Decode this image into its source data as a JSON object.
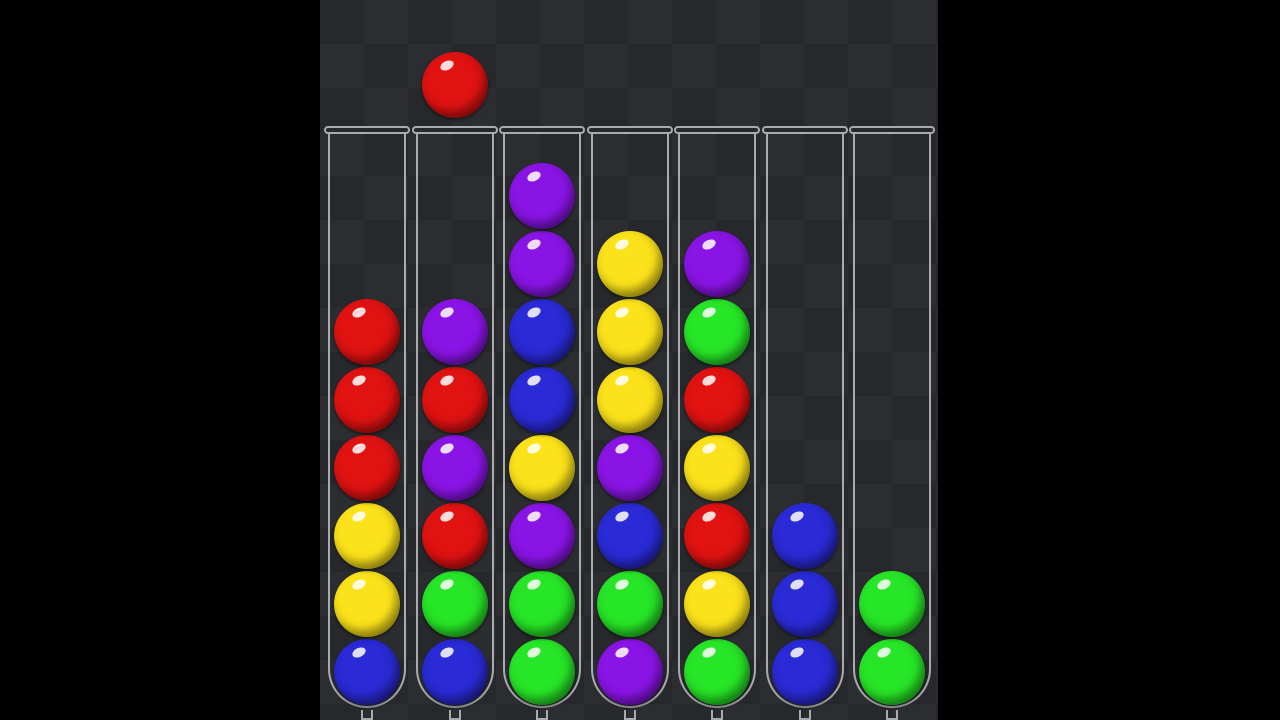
{
  "game": {
    "colors": {
      "red": "#e01212",
      "purple": "#8a14e6",
      "blue": "#2a2ad6",
      "yellow": "#fbe21a",
      "green": "#27e527"
    },
    "held_ball": {
      "color": "red",
      "above_tube": 1
    },
    "tubes": [
      {
        "balls_bottom_to_top": [
          "blue",
          "yellow",
          "yellow",
          "red",
          "red",
          "red"
        ]
      },
      {
        "balls_bottom_to_top": [
          "blue",
          "green",
          "red",
          "purple",
          "red",
          "purple"
        ]
      },
      {
        "balls_bottom_to_top": [
          "green",
          "green",
          "purple",
          "yellow",
          "blue",
          "blue",
          "purple",
          "purple"
        ]
      },
      {
        "balls_bottom_to_top": [
          "purple",
          "green",
          "blue",
          "purple",
          "yellow",
          "yellow",
          "yellow"
        ]
      },
      {
        "balls_bottom_to_top": [
          "green",
          "yellow",
          "red",
          "yellow",
          "red",
          "green",
          "purple"
        ]
      },
      {
        "balls_bottom_to_top": [
          "blue",
          "blue",
          "blue"
        ]
      },
      {
        "balls_bottom_to_top": [
          "green",
          "green"
        ]
      }
    ]
  }
}
